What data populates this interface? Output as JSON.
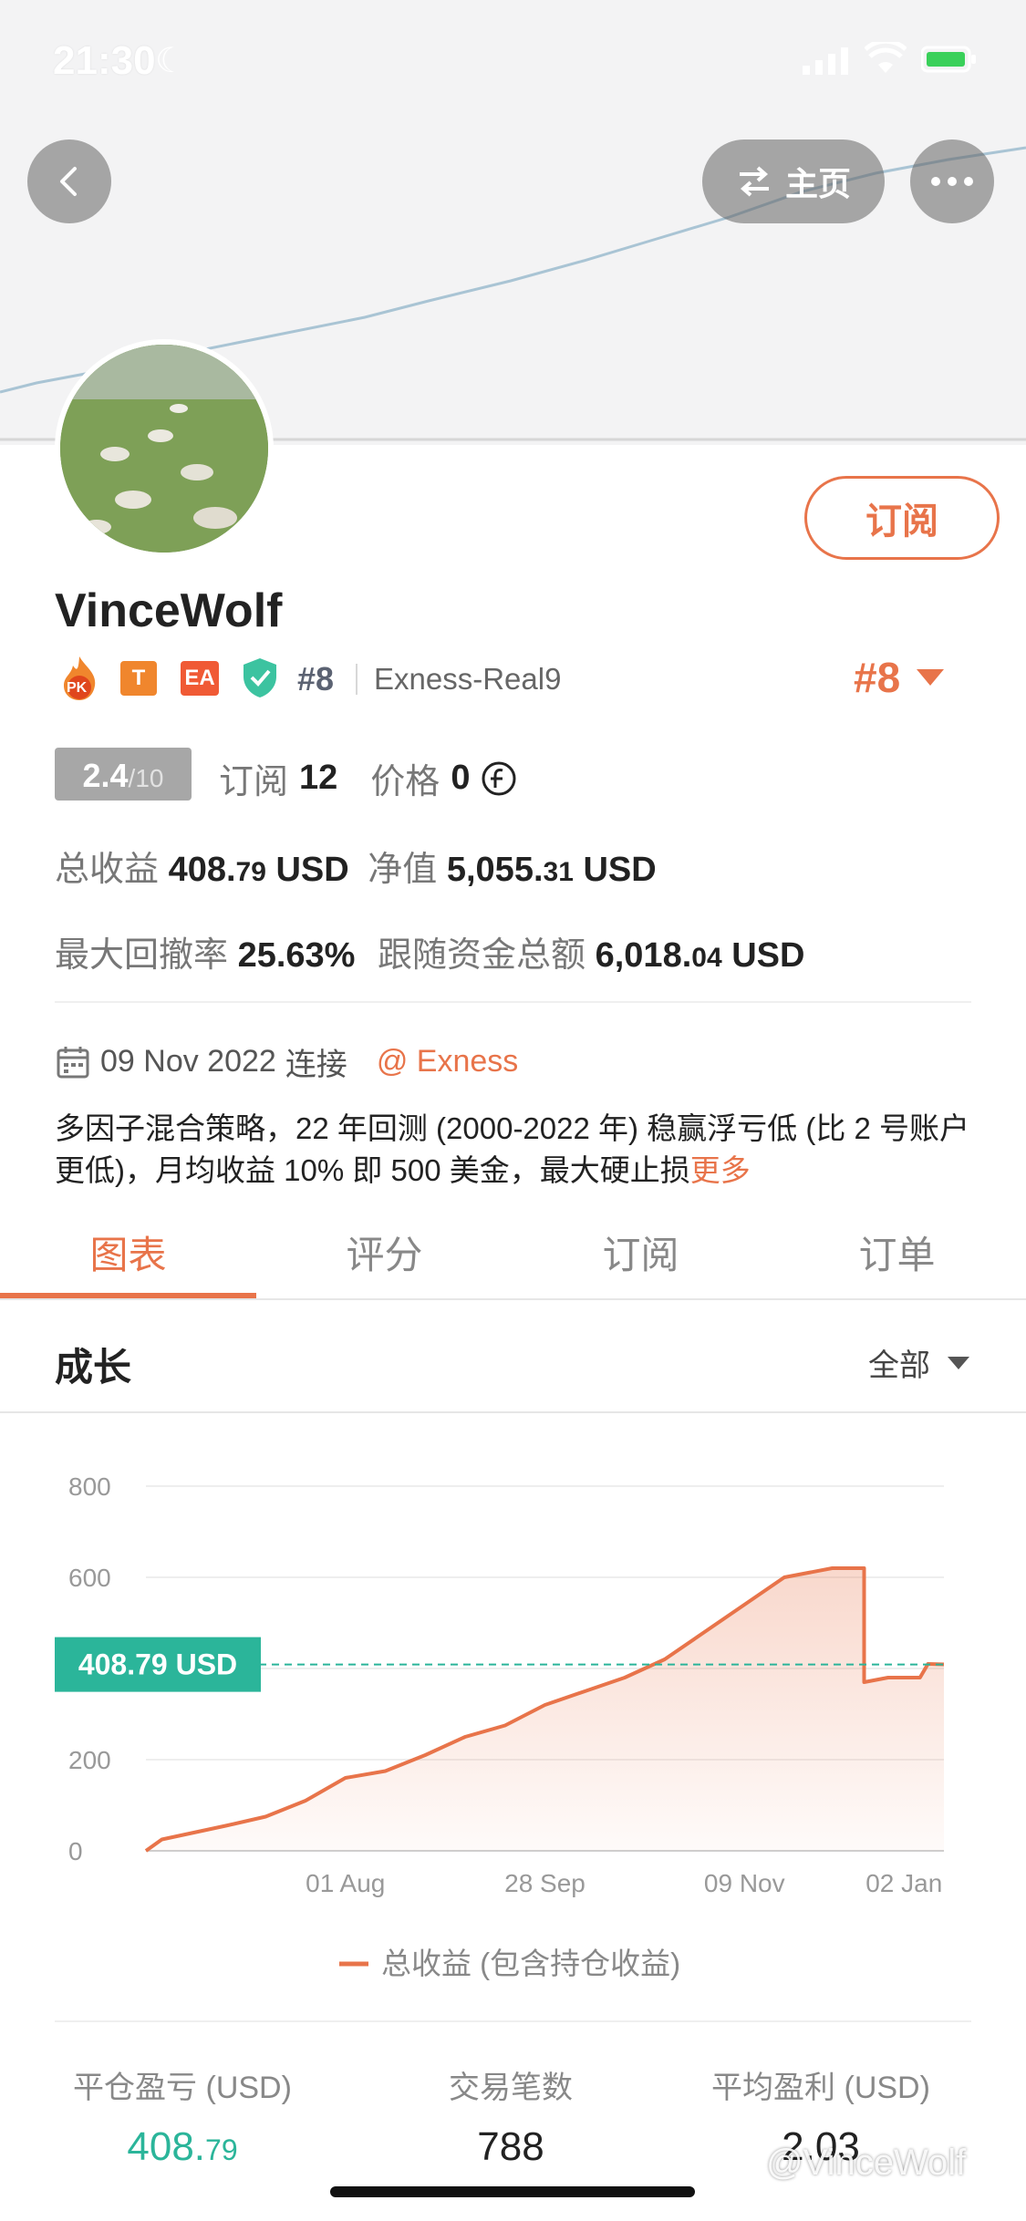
{
  "status_bar": {
    "time": "21:30"
  },
  "nav": {
    "home_label": "主页"
  },
  "profile": {
    "username": "VinceWolf",
    "subscribe_label": "订阅",
    "badges": [
      "PK",
      "T",
      "EA"
    ],
    "rank_small": "#8",
    "broker_account": "Exness-Real9",
    "rank_big": "#8"
  },
  "stats": {
    "score": "2.4",
    "score_max": "/10",
    "subscribe_label": "订阅",
    "subscribe_count": "12",
    "price_label": "价格",
    "price_value": "0",
    "total_profit_label": "总收益",
    "total_profit_int": "408.",
    "total_profit_dec": "79",
    "total_profit_unit": "USD",
    "equity_label": "净值",
    "equity_int": "5,055.",
    "equity_dec": "31",
    "equity_unit": "USD",
    "max_drawdown_label": "最大回撤率",
    "max_drawdown_value": "25.63%",
    "follow_funds_label": "跟随资金总额",
    "follow_funds_int": "6,018.",
    "follow_funds_dec": "04",
    "follow_funds_unit": "USD"
  },
  "connection": {
    "date": "09 Nov 2022",
    "connected_label": "连接",
    "broker": "@ Exness"
  },
  "description": {
    "text": "多因子混合策略，22 年回测 (2000-2022 年) 稳赢浮亏低 (比 2 号账户更低)，月均收益 10% 即 500 美金，最大硬止损",
    "more_label": "更多"
  },
  "tabs": [
    "图表",
    "评分",
    "订阅",
    "订单"
  ],
  "active_tab": 0,
  "growth": {
    "title": "成长",
    "filter_label": "全部"
  },
  "chart_data": {
    "type": "area",
    "y_ticks": [
      "800",
      "600",
      "200",
      "0"
    ],
    "x_ticks": [
      "01 Aug",
      "28 Sep",
      "09 Nov",
      "02 Jan"
    ],
    "ylim": [
      0,
      800
    ],
    "current_label": "408.79 USD",
    "current_value": 408.79,
    "legend": "总收益 (包含持仓收益)",
    "series": [
      {
        "name": "总收益 (包含持仓收益)",
        "color": "#e8744a",
        "x": [
          0,
          0.02,
          0.06,
          0.1,
          0.15,
          0.2,
          0.25,
          0.3,
          0.35,
          0.4,
          0.45,
          0.5,
          0.55,
          0.6,
          0.65,
          0.7,
          0.75,
          0.8,
          0.83,
          0.86,
          0.9,
          0.9,
          0.93,
          0.97,
          0.98,
          1.0
        ],
        "y": [
          0,
          25,
          40,
          55,
          75,
          110,
          160,
          175,
          210,
          250,
          275,
          320,
          350,
          380,
          420,
          480,
          540,
          600,
          610,
          620,
          620,
          370,
          380,
          380,
          410,
          409
        ]
      }
    ]
  },
  "bottom_stats": {
    "closed_pl_label": "平仓盈亏 (USD)",
    "closed_pl_int": "408.",
    "closed_pl_dec": "79",
    "trades_label": "交易笔数",
    "trades_value": "788",
    "avg_profit_label": "平均盈利 (USD)",
    "avg_profit_value": "2.03"
  },
  "watermark": "@VinceWolf",
  "colors": {
    "accent": "#e8744a",
    "green": "#2bb59a",
    "badge_orange": "#f0862d",
    "badge_ea": "#f05a35"
  }
}
